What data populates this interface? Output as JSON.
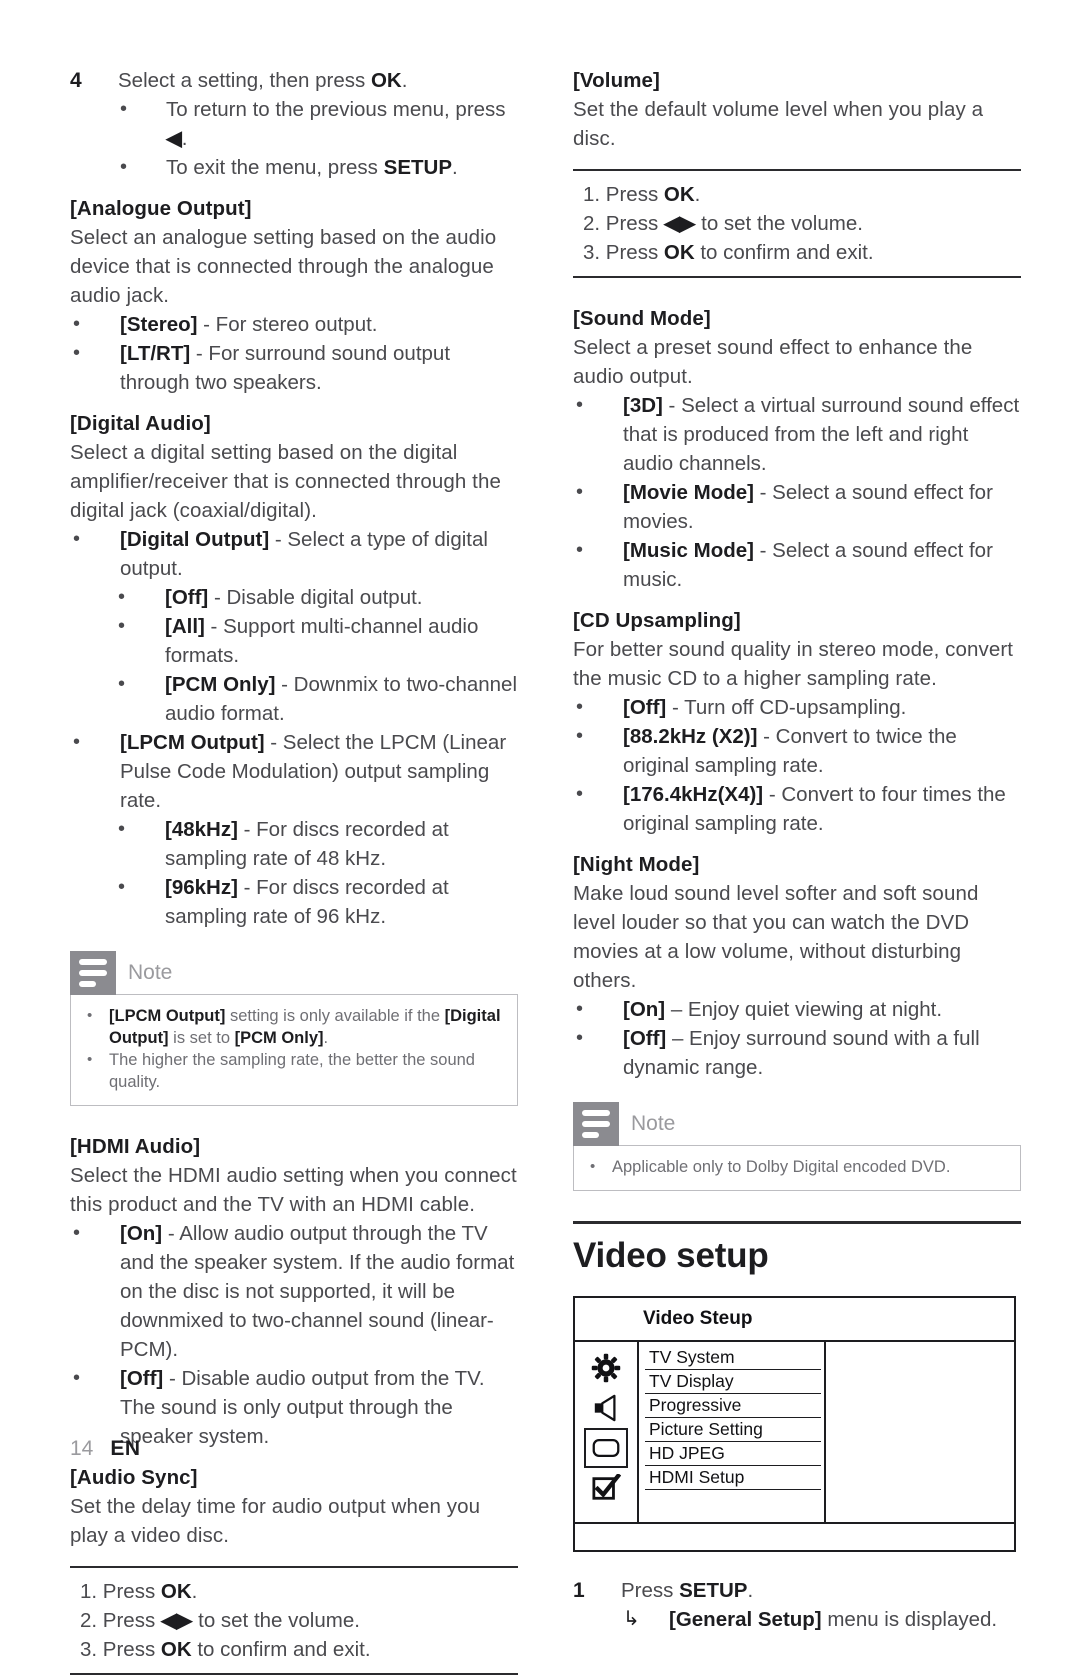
{
  "page": {
    "number": "14",
    "language": "EN"
  },
  "left_column": {
    "step4": {
      "number": "4",
      "text_pre": "Select a setting, then press ",
      "bold": "OK",
      "text_post": ".",
      "bullets": [
        {
          "pre": "To return to the previous menu, press ",
          "glyph": "◀",
          "post": "."
        },
        {
          "pre": "To exit the menu, press ",
          "bold": "SETUP",
          "post": "."
        }
      ]
    },
    "analogue_output": {
      "heading": "[Analogue Output]",
      "body": "Select an analogue setting based on the audio device that is connected through the analogue audio jack.",
      "bullets": [
        {
          "term": "[Stereo]",
          "desc": " - For stereo output."
        },
        {
          "term": "[LT/RT]",
          "desc": " - For surround sound output through two speakers."
        }
      ]
    },
    "digital_audio": {
      "heading": "[Digital Audio]",
      "body": "Select a digital setting based on the digital amplifier/receiver that is connected through the digital jack (coaxial/digital).",
      "digital_output": {
        "term": "[Digital Output]",
        "desc": " - Select a type of digital output.",
        "sub": [
          {
            "term": "[Off]",
            "desc": " - Disable digital output."
          },
          {
            "term": "[All]",
            "desc": " - Support multi-channel audio formats."
          },
          {
            "term": "[PCM Only]",
            "desc": " - Downmix to two-channel audio format."
          }
        ]
      },
      "lpcm_output": {
        "term": "[LPCM Output]",
        "desc": " - Select the LPCM (Linear Pulse Code Modulation) output sampling rate.",
        "sub": [
          {
            "term": "[48kHz]",
            "desc": " - For discs recorded at sampling rate of 48 kHz."
          },
          {
            "term": "[96kHz]",
            "desc": " - For discs recorded at sampling rate of 96 kHz."
          }
        ]
      }
    },
    "note": {
      "title": "Note",
      "icon": "note-lines-icon",
      "items": [
        {
          "parts": [
            {
              "text": "[LPCM Output]",
              "bold": true
            },
            {
              "text": " setting is only available if the ",
              "bold": false
            },
            {
              "text": "[Digital Output]",
              "bold": true
            },
            {
              "text": " is set to ",
              "bold": false
            },
            {
              "text": "[PCM Only]",
              "bold": true
            },
            {
              "text": ".",
              "bold": false
            }
          ]
        },
        {
          "parts": [
            {
              "text": "The higher the sampling rate, the better the sound quality.",
              "bold": false
            }
          ]
        }
      ]
    },
    "hdmi_audio": {
      "heading": "[HDMI Audio]",
      "body": "Select the HDMI audio setting when you connect this product and the TV with an HDMI cable.",
      "bullets": [
        {
          "term": "[On]",
          "desc": " - Allow audio output through the TV and the speaker system. If the audio format on the disc is not supported, it will be downmixed to two-channel sound (linear-PCM)."
        },
        {
          "term": "[Off]",
          "desc": " - Disable audio output from the TV. The sound is only output through the speaker system."
        }
      ]
    },
    "audio_sync": {
      "heading": "[Audio Sync]",
      "body": "Set the delay time for audio output when you play a video disc.",
      "procedure": [
        {
          "num": "1. Press ",
          "bold": "OK",
          "post": "."
        },
        {
          "num": "2. Press ",
          "glyph": "◀▶",
          "post": " to set the volume."
        },
        {
          "num": "3. Press ",
          "bold": "OK",
          "post": " to confirm and exit."
        }
      ]
    }
  },
  "right_column": {
    "volume": {
      "heading": "[Volume]",
      "body": "Set the default volume level when you play a disc.",
      "procedure": [
        {
          "num": "1. Press ",
          "bold": "OK",
          "post": "."
        },
        {
          "num": "2. Press ",
          "glyph": "◀▶",
          "post": " to set the volume."
        },
        {
          "num": "3. Press ",
          "bold": "OK",
          "post": " to confirm and exit."
        }
      ]
    },
    "sound_mode": {
      "heading": "[Sound Mode]",
      "body": "Select a preset sound effect to enhance the audio output.",
      "bullets": [
        {
          "term": "[3D]",
          "desc": " - Select a virtual surround sound effect that is produced from the left and right audio channels."
        },
        {
          "term": "[Movie Mode]",
          "desc": " - Select a sound effect for movies."
        },
        {
          "term": "[Music Mode]",
          "desc": " - Select a sound effect for music."
        }
      ]
    },
    "cd_upsampling": {
      "heading": "[CD Upsampling]",
      "body": "For better sound quality in stereo mode, convert the music CD to a higher sampling rate.",
      "bullets": [
        {
          "term": "[Off]",
          "desc": " - Turn off CD-upsampling."
        },
        {
          "term": "[88.2kHz (X2)]",
          "desc": " - Convert to twice the original sampling rate."
        },
        {
          "term": "[176.4kHz(X4)]",
          "desc": " - Convert to four times the original sampling rate."
        }
      ]
    },
    "night_mode": {
      "heading": "[Night Mode]",
      "body": "Make loud sound level softer and soft sound level louder so that you can watch the DVD movies at a low volume, without disturbing others.",
      "bullets": [
        {
          "term": "[On]",
          "desc": " – Enjoy quiet viewing at night."
        },
        {
          "term": "[Off]",
          "desc": " – Enjoy surround sound with a full dynamic range."
        }
      ]
    },
    "note": {
      "title": "Note",
      "icon": "note-lines-icon",
      "items": [
        {
          "parts": [
            {
              "text": "Applicable only to Dolby Digital encoded DVD.",
              "bold": false
            }
          ]
        }
      ]
    },
    "video_setup": {
      "section_title": "Video setup",
      "osd": {
        "title": "Video Steup",
        "icons": [
          {
            "name": "gear-icon",
            "selected": false
          },
          {
            "name": "speaker-icon",
            "selected": false
          },
          {
            "name": "tv-display-icon",
            "selected": true
          },
          {
            "name": "checkbox-check-icon",
            "selected": false
          }
        ],
        "menu_items": [
          "TV System",
          "TV Display",
          "Progressive",
          "Picture Setting",
          "HD JPEG",
          "HDMI Setup"
        ]
      },
      "step1": {
        "number": "1",
        "text_pre": "Press ",
        "bold": "SETUP",
        "text_post": ".",
        "result": {
          "arrow": "↳",
          "bold": "[General Setup]",
          "text": " menu is displayed."
        }
      }
    }
  }
}
